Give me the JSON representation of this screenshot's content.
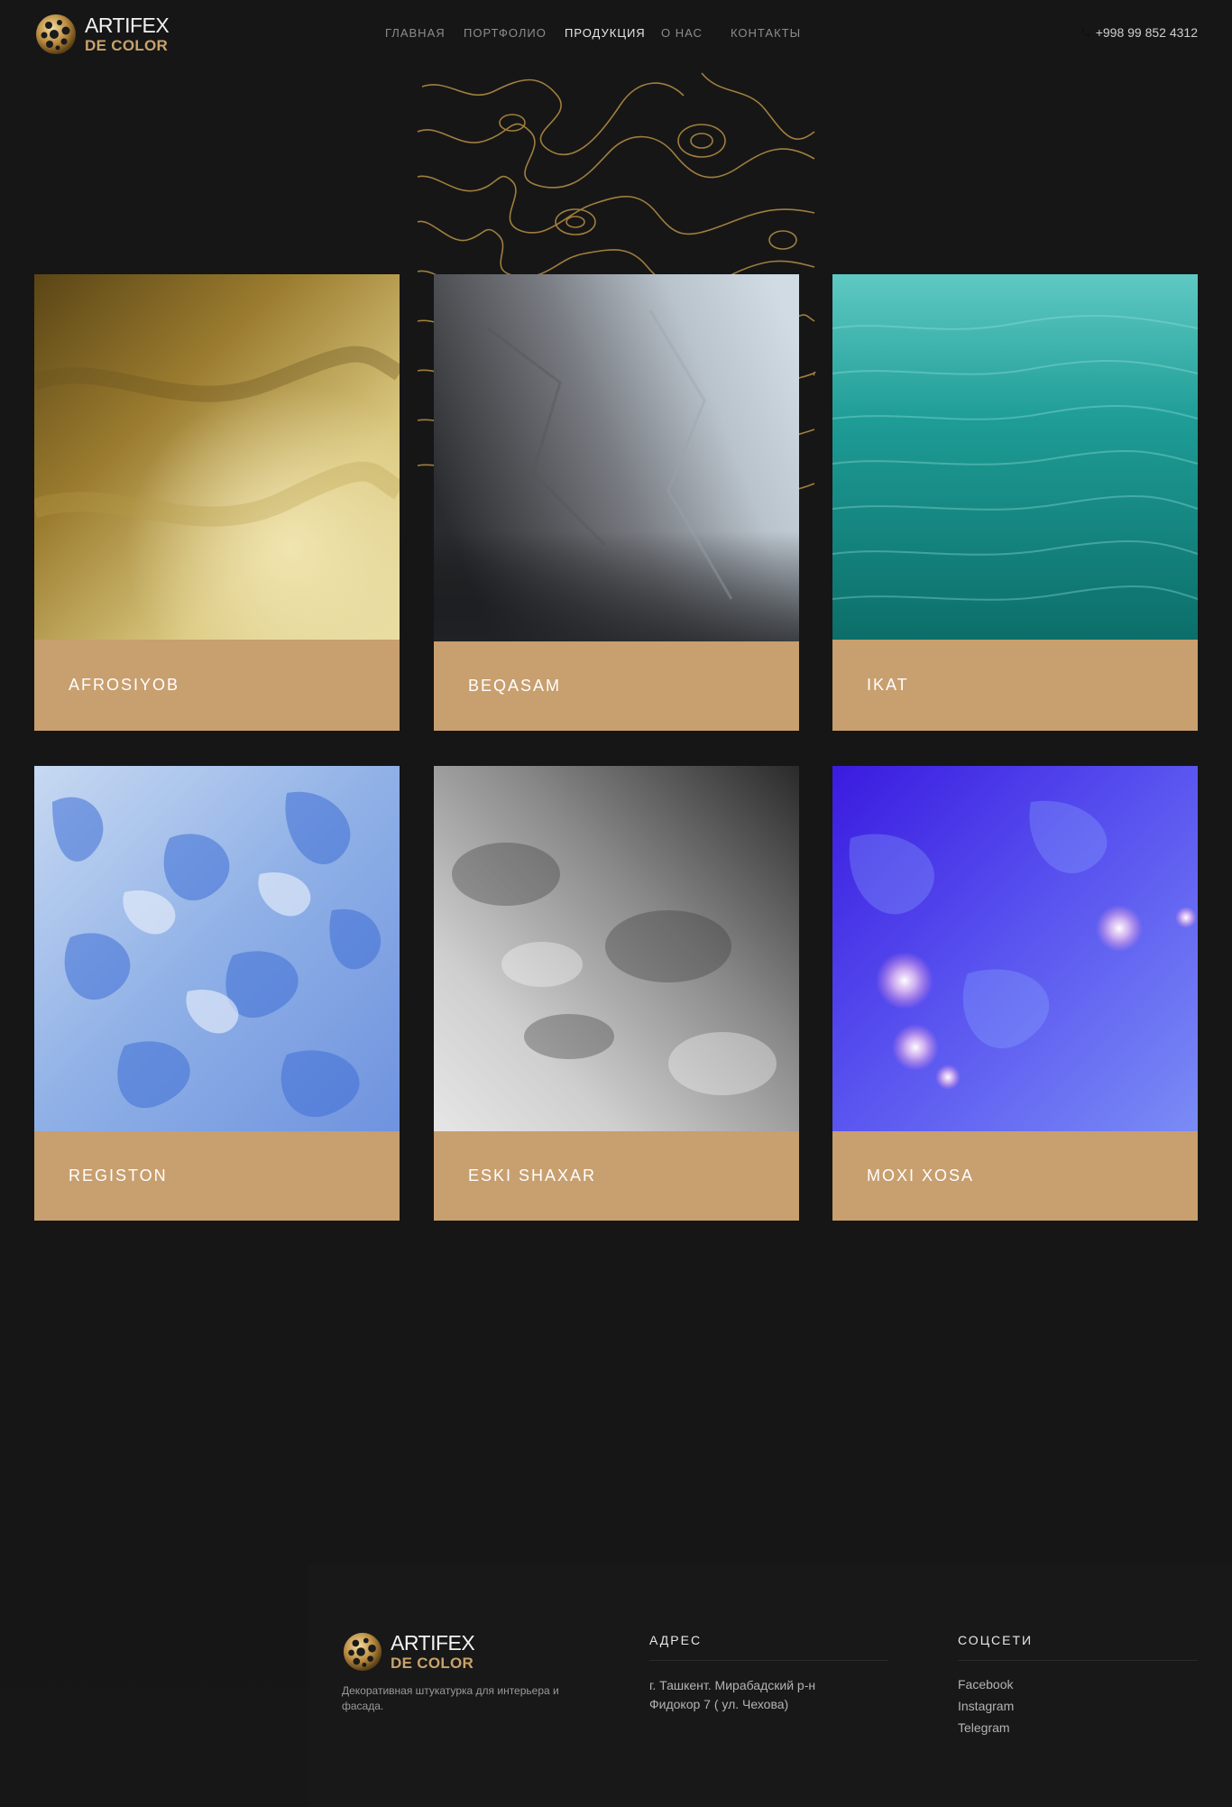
{
  "header": {
    "logo_line1": "ARTIFEX",
    "logo_line2_de": "DE",
    "logo_line2_color": "COLOR",
    "nav": [
      {
        "label": "ГЛАВНАЯ"
      },
      {
        "label": "ПОРТФОЛИО"
      },
      {
        "label": "ПРОДУКЦИЯ"
      },
      {
        "label": "О НАС"
      },
      {
        "label": "КОНТАКТЫ"
      }
    ],
    "active_nav": "ПРОДУКЦИЯ",
    "phone": "+998 99 852 4312"
  },
  "products": [
    {
      "name": "AFROSIYOB",
      "swatch": "gold"
    },
    {
      "name": "BEQASAM",
      "swatch": "grey-silver"
    },
    {
      "name": "IKAT",
      "swatch": "teal"
    },
    {
      "name": "REGISTON",
      "swatch": "blue-white"
    },
    {
      "name": "ESKI SHAXAR",
      "swatch": "grey-concrete"
    },
    {
      "name": "MOXI XOSA",
      "swatch": "violet-blue"
    }
  ],
  "footer": {
    "logo_line1": "ARTIFEX",
    "logo_line2_de": "DE",
    "logo_line2_color": "COLOR",
    "description": "Декоративная штукатурка для интерьера и фасада.",
    "address_title": "АДРЕС",
    "address_line1": "г. Ташкент. Мирабадский р-н",
    "address_line2": "Фидокор 7 ( ул. Чехова)",
    "social_title": "СОЦСЕТИ",
    "social": [
      "Facebook",
      "Instagram",
      "Telegram"
    ]
  },
  "colors": {
    "background": "#161616",
    "accent_label": "#c89f6f",
    "logo_gold": "#c9a36a"
  }
}
